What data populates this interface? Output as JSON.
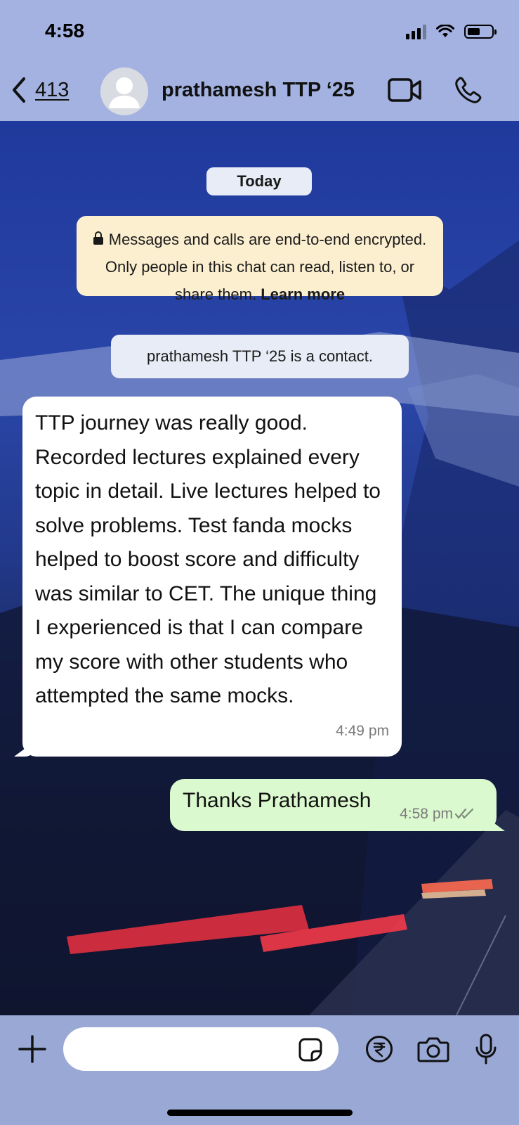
{
  "status_bar": {
    "time": "4:58"
  },
  "header": {
    "back_count": "413",
    "contact_name": "prathamesh TTP ‘25",
    "icons": [
      "chevron-left-icon",
      "video-call-icon",
      "phone-icon"
    ]
  },
  "chat": {
    "date_pill": "Today",
    "encryption_notice": {
      "text": "Messages and calls are end-to-end encrypted. Only people in this chat can read, listen to, or share them.",
      "link": "Learn more"
    },
    "contact_notice": "prathamesh TTP ‘25 is a contact.",
    "messages": [
      {
        "direction": "incoming",
        "text": "TTP journey was really good. Recorded lectures explained every topic in detail. Live lectures helped to solve problems. Test fanda mocks helped to boost score and difficulty was similar to CET. The unique thing I experienced is that I can compare my score with other students who attempted the same mocks.",
        "time": "4:49 pm"
      },
      {
        "direction": "outgoing",
        "text": "Thanks Prathamesh",
        "time": "4:58 pm",
        "status": "read"
      }
    ]
  },
  "composer": {
    "placeholder": "",
    "icons": [
      "plus-icon",
      "sticker-icon",
      "rupee-payment-icon",
      "camera-icon",
      "microphone-icon"
    ]
  },
  "colors": {
    "header_bg": "#a3b2e0",
    "incoming_bubble": "#ffffff",
    "outgoing_bubble": "#dbf9cf",
    "encryption_bg": "#fcefd0"
  }
}
